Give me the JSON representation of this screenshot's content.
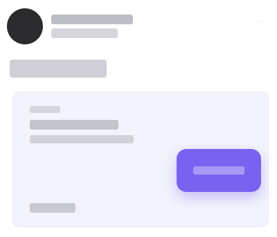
{
  "header": {
    "avatar": "",
    "name": "",
    "subtitle": "",
    "menu_icon": "more-horizontal-icon"
  },
  "section": {
    "title": ""
  },
  "card": {
    "label": "",
    "title": "",
    "subtitle": "",
    "footer": "",
    "button_label": ""
  },
  "colors": {
    "accent": "#7a62f0",
    "card_background": "#f2f3fc",
    "avatar_background": "#2b2b2e"
  }
}
